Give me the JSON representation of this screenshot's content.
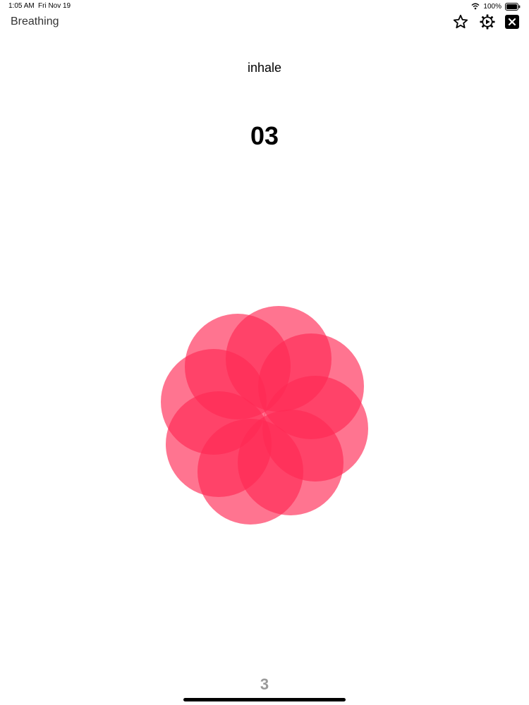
{
  "status_bar": {
    "time": "1:05 AM",
    "date": "Fri Nov 19",
    "battery": "100%",
    "icons": [
      "wifi-icon",
      "battery-icon"
    ]
  },
  "nav": {
    "title": "Breathing",
    "buttons": [
      "star-icon",
      "gear-play-icon",
      "close-icon"
    ]
  },
  "session": {
    "phase": "inhale",
    "countdown": "03",
    "cycle": "3"
  },
  "colors": {
    "petal": "#ff2a55",
    "cycle_text": "#9a9a9a"
  }
}
